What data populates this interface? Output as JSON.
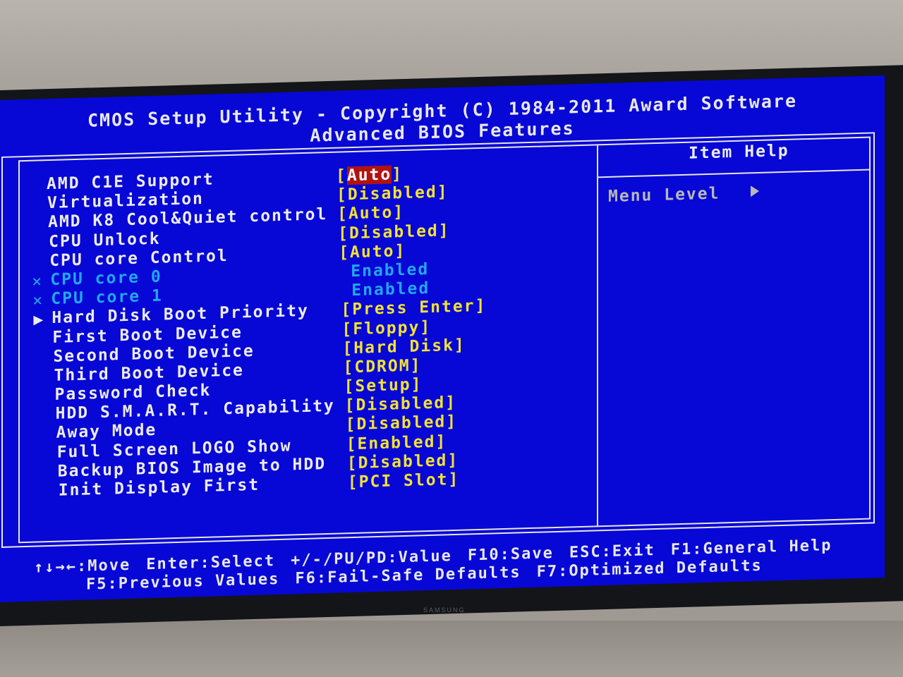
{
  "header": {
    "title": "CMOS Setup Utility - Copyright (C) 1984-2011 Award Software",
    "subtitle": "Advanced BIOS Features"
  },
  "settings": [
    {
      "label": "AMD C1E Support",
      "value": "Auto",
      "marker": "",
      "bracketed": true,
      "selected": true,
      "disabled": false
    },
    {
      "label": "Virtualization",
      "value": "Disabled",
      "marker": "",
      "bracketed": true,
      "selected": false,
      "disabled": false
    },
    {
      "label": "AMD K8 Cool&Quiet control",
      "value": "Auto",
      "marker": "",
      "bracketed": true,
      "selected": false,
      "disabled": false
    },
    {
      "label": "CPU Unlock",
      "value": "Disabled",
      "marker": "",
      "bracketed": true,
      "selected": false,
      "disabled": false
    },
    {
      "label": "CPU core Control",
      "value": "Auto",
      "marker": "",
      "bracketed": true,
      "selected": false,
      "disabled": false
    },
    {
      "label": "CPU core 0",
      "value": "Enabled",
      "marker": "x",
      "bracketed": false,
      "selected": false,
      "disabled": true
    },
    {
      "label": "CPU core 1",
      "value": "Enabled",
      "marker": "x",
      "bracketed": false,
      "selected": false,
      "disabled": true
    },
    {
      "label": "Hard Disk Boot Priority",
      "value": "Press Enter",
      "marker": "submenu",
      "bracketed": true,
      "selected": false,
      "disabled": false
    },
    {
      "label": "First Boot Device",
      "value": "Floppy",
      "marker": "",
      "bracketed": true,
      "selected": false,
      "disabled": false
    },
    {
      "label": "Second Boot Device",
      "value": "Hard Disk",
      "marker": "",
      "bracketed": true,
      "selected": false,
      "disabled": false
    },
    {
      "label": "Third Boot Device",
      "value": "CDROM",
      "marker": "",
      "bracketed": true,
      "selected": false,
      "disabled": false
    },
    {
      "label": "Password Check",
      "value": "Setup",
      "marker": "",
      "bracketed": true,
      "selected": false,
      "disabled": false
    },
    {
      "label": "HDD S.M.A.R.T. Capability",
      "value": "Disabled",
      "marker": "",
      "bracketed": true,
      "selected": false,
      "disabled": false
    },
    {
      "label": "Away Mode",
      "value": "Disabled",
      "marker": "",
      "bracketed": true,
      "selected": false,
      "disabled": false
    },
    {
      "label": "Full Screen LOGO Show",
      "value": "Enabled",
      "marker": "",
      "bracketed": true,
      "selected": false,
      "disabled": false
    },
    {
      "label": "Backup BIOS Image to HDD",
      "value": "Disabled",
      "marker": "",
      "bracketed": true,
      "selected": false,
      "disabled": false
    },
    {
      "label": "Init Display First",
      "value": "PCI Slot",
      "marker": "",
      "bracketed": true,
      "selected": false,
      "disabled": false
    }
  ],
  "help_panel": {
    "title": "Item Help",
    "menu_level_label": "Menu Level",
    "menu_level_icon": "right-triangle-icon"
  },
  "footer": {
    "row1": [
      "↑↓→←:Move",
      "Enter:Select",
      "+/-/PU/PD:Value",
      "F10:Save",
      "ESC:Exit",
      "F1:General Help"
    ],
    "row2": [
      "F5:Previous Values",
      "F6:Fail-Safe Defaults",
      "F7:Optimized Defaults"
    ]
  },
  "monitor": {
    "brand": "SAMSUNG"
  },
  "colors": {
    "background": "#0707d6",
    "label": "#ececec",
    "value": "#f2e233",
    "disabled": "#22a8f0",
    "highlight": "#b11212",
    "frame": "#e6e6e6"
  }
}
